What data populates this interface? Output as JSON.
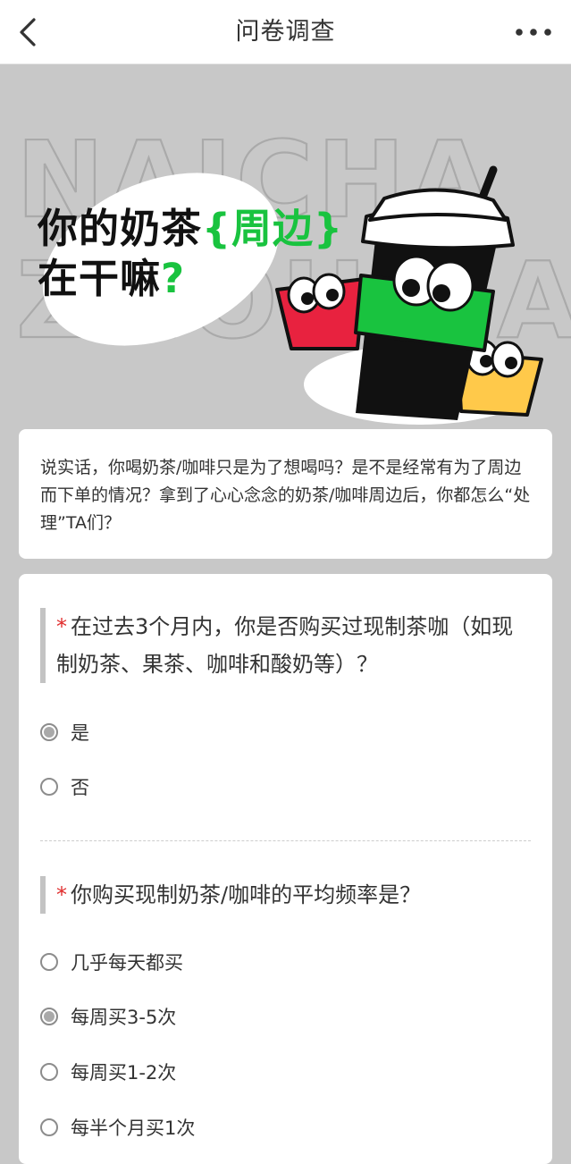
{
  "nav": {
    "title": "问卷调查",
    "back_icon": "chevron-left-icon",
    "more_icon": "more-dots-icon"
  },
  "hero": {
    "bg_text_line1": "NAICHA",
    "bg_text_line2": "ZHOUBIAN",
    "title_part1": "你的奶茶",
    "title_accent": "{周边}",
    "title_part2": "在干嘛",
    "title_qmark": "?",
    "accent_color": "#19c33f"
  },
  "intro": {
    "text": "说实话，你喝奶茶/咖啡只是为了想喝吗？是不是经常有为了周边而下单的情况？拿到了心心念念的奶茶/咖啡周边后，你都怎么“处理”TA们？"
  },
  "questions": [
    {
      "required_mark": "*",
      "title": "在过去3个月内，你是否购买过现制茶咖（如现制奶茶、果茶、咖啡和酸奶等）？",
      "options": [
        {
          "label": "是",
          "selected": true
        },
        {
          "label": "否",
          "selected": false
        }
      ]
    },
    {
      "required_mark": "*",
      "title": "你购买现制奶茶/咖啡的平均频率是？",
      "options": [
        {
          "label": "几乎每天都买",
          "selected": false
        },
        {
          "label": "每周买3-5次",
          "selected": true
        },
        {
          "label": "每周买1-2次",
          "selected": false
        },
        {
          "label": "每半个月买1次",
          "selected": false
        }
      ]
    }
  ]
}
